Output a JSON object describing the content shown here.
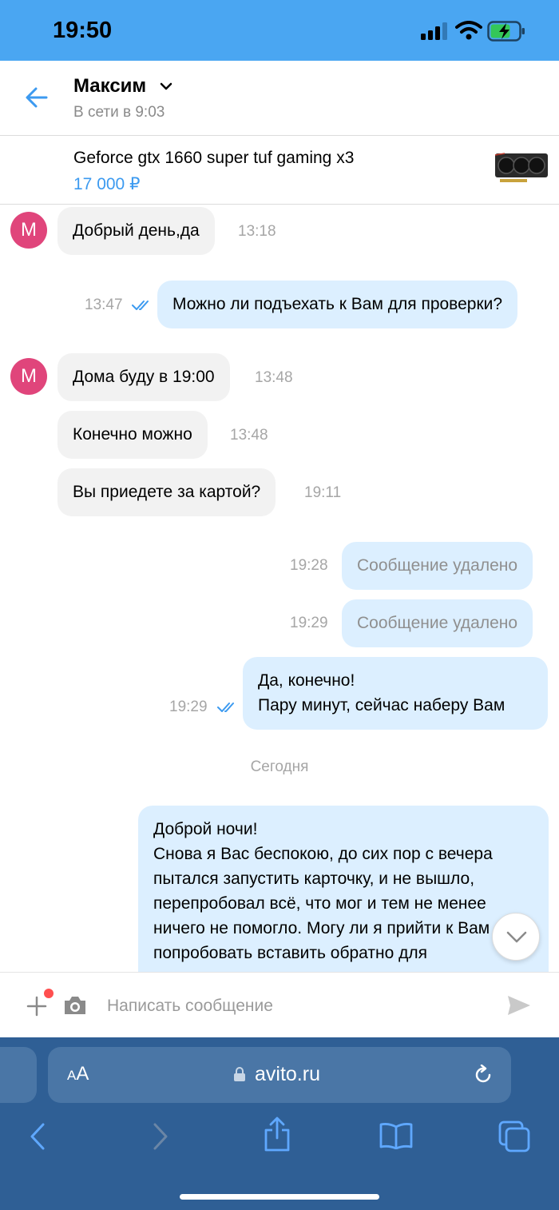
{
  "status_bar": {
    "time": "19:50"
  },
  "header": {
    "contact_name": "Максим",
    "contact_status": "В сети в 9:03"
  },
  "listing": {
    "title": "Geforce gtx 1660 super tuf gaming x3",
    "price": "17 000 ₽"
  },
  "messages": [
    {
      "direction": "in",
      "avatar": "М",
      "text": "Добрый день,да",
      "time": "13:18"
    },
    {
      "direction": "out",
      "text": "Можно ли подъехать к Вам для проверки?",
      "time": "13:47",
      "read": true
    },
    {
      "direction": "in",
      "avatar": "М",
      "text": "Дома буду в 19:00",
      "time": "13:48"
    },
    {
      "direction": "in",
      "text": "Конечно можно",
      "time": "13:48"
    },
    {
      "direction": "in",
      "text": "Вы приедете за картой?",
      "time": "19:11"
    },
    {
      "direction": "out",
      "text": "Сообщение удалено",
      "time": "19:28",
      "deleted": true
    },
    {
      "direction": "out",
      "text": "Сообщение удалено",
      "time": "19:29",
      "deleted": true
    },
    {
      "direction": "out",
      "text": "Да, конечно!\nПару минут,  сейчас наберу Вам",
      "time": "19:29",
      "read": true
    },
    {
      "direction": "out",
      "text": "Доброй ночи!\nСнова я Вас беспокою, до сих пор с вечера пытался запустить карточку, и не вышло, перепробовал всё, что мог и тем не менее ничего не помогло. Могу ли я прийти к Вам и попробовать вставить обратно для"
    }
  ],
  "day_separator": "Сегодня",
  "composer": {
    "placeholder": "Написать сообщение"
  },
  "browser": {
    "aa_small": "A",
    "aa_large": "A",
    "url": "avito.ru"
  },
  "colors": {
    "accent": "#4aa6f2",
    "price": "#3c9af0",
    "avatar": "#e0457b",
    "outgoing_bubble": "#dcefff",
    "incoming_bubble": "#f2f2f2",
    "safari_bar": "#2f5f95"
  },
  "icons": [
    "back-arrow-icon",
    "chevron-down-icon",
    "plus-icon",
    "camera-icon",
    "send-icon",
    "lock-icon",
    "reload-icon",
    "safari-back-icon",
    "safari-forward-icon",
    "share-icon",
    "bookmarks-icon",
    "tabs-icon",
    "double-check-icon"
  ]
}
